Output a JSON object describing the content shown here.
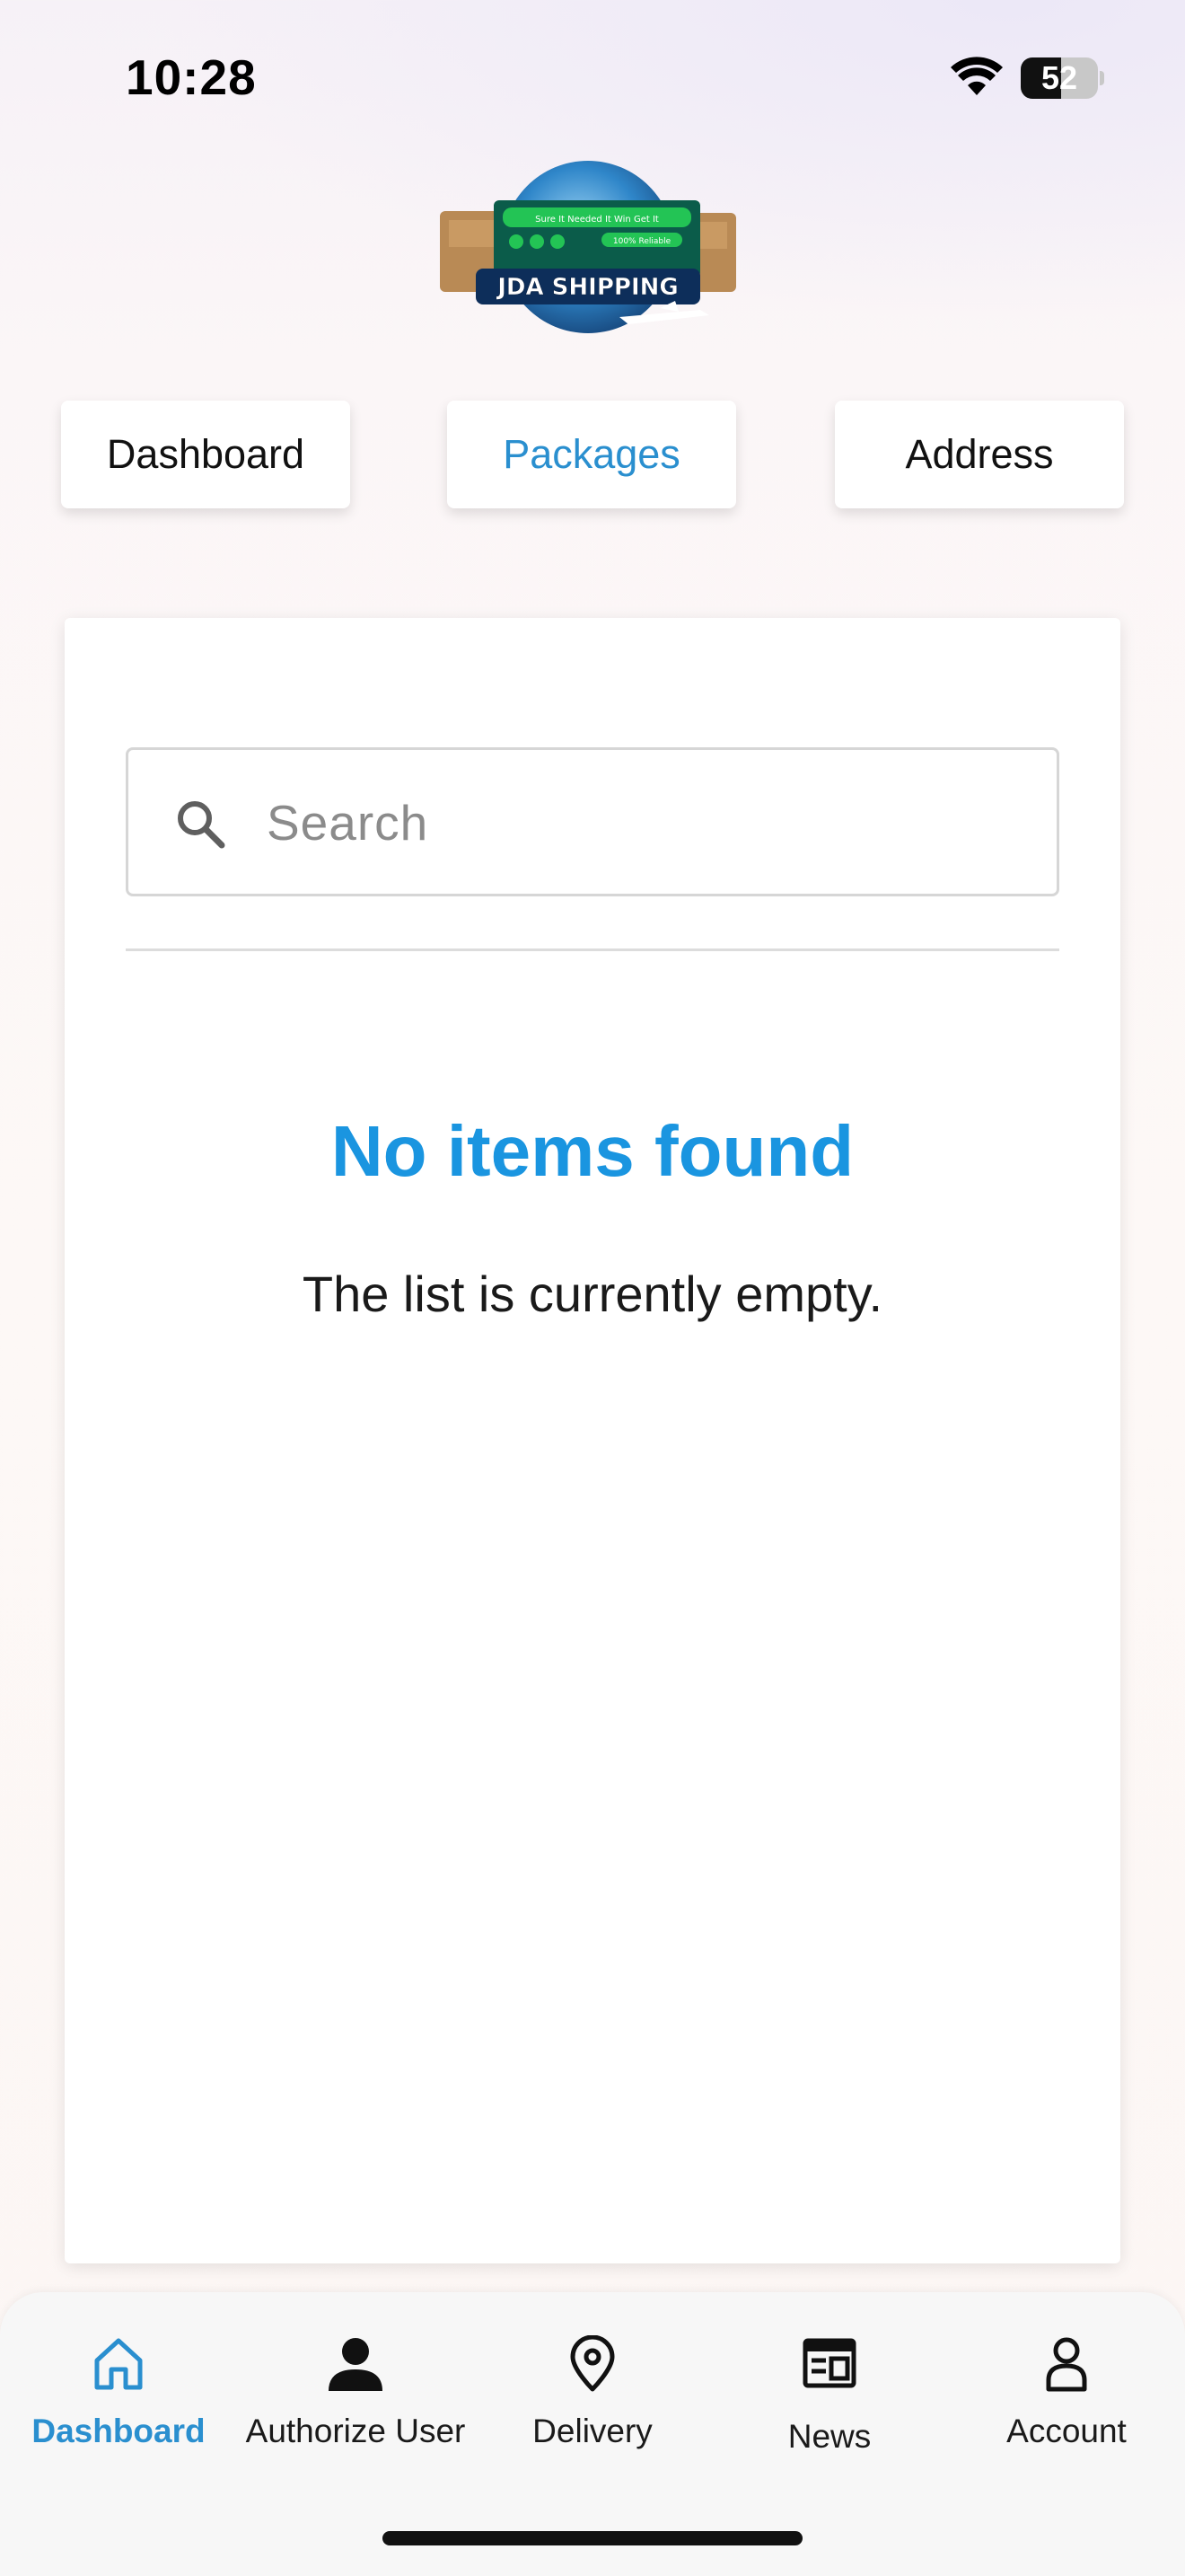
{
  "status_bar": {
    "time": "10:28",
    "battery_level": "52",
    "icons": [
      "wifi-icon",
      "battery-icon"
    ]
  },
  "logo": {
    "brand_text": "JDA SHIPPING",
    "tagline": "Sure! It Needed It Win Get It",
    "badge": "100% Reliable"
  },
  "top_tabs": [
    {
      "label": "Dashboard",
      "active": false
    },
    {
      "label": "Packages",
      "active": true
    },
    {
      "label": "Address",
      "active": false
    }
  ],
  "search": {
    "placeholder": "Search",
    "value": "",
    "icon": "search-icon"
  },
  "empty_state": {
    "title": "No items found",
    "message": "The list is currently empty."
  },
  "bottom_nav": [
    {
      "label": "Dashboard",
      "icon": "home-icon",
      "active": true
    },
    {
      "label": "Authorize User",
      "icon": "person-icon",
      "active": false
    },
    {
      "label": "Delivery",
      "icon": "location-pin-icon",
      "active": false
    },
    {
      "label": "News",
      "icon": "newspaper-icon",
      "active": false
    },
    {
      "label": "Account",
      "icon": "account-icon",
      "active": false
    }
  ],
  "colors": {
    "accent": "#2a8fcf",
    "empty_title": "#1a95e0",
    "card_bg": "#ffffff",
    "nav_bg": "#f7f7f7"
  }
}
